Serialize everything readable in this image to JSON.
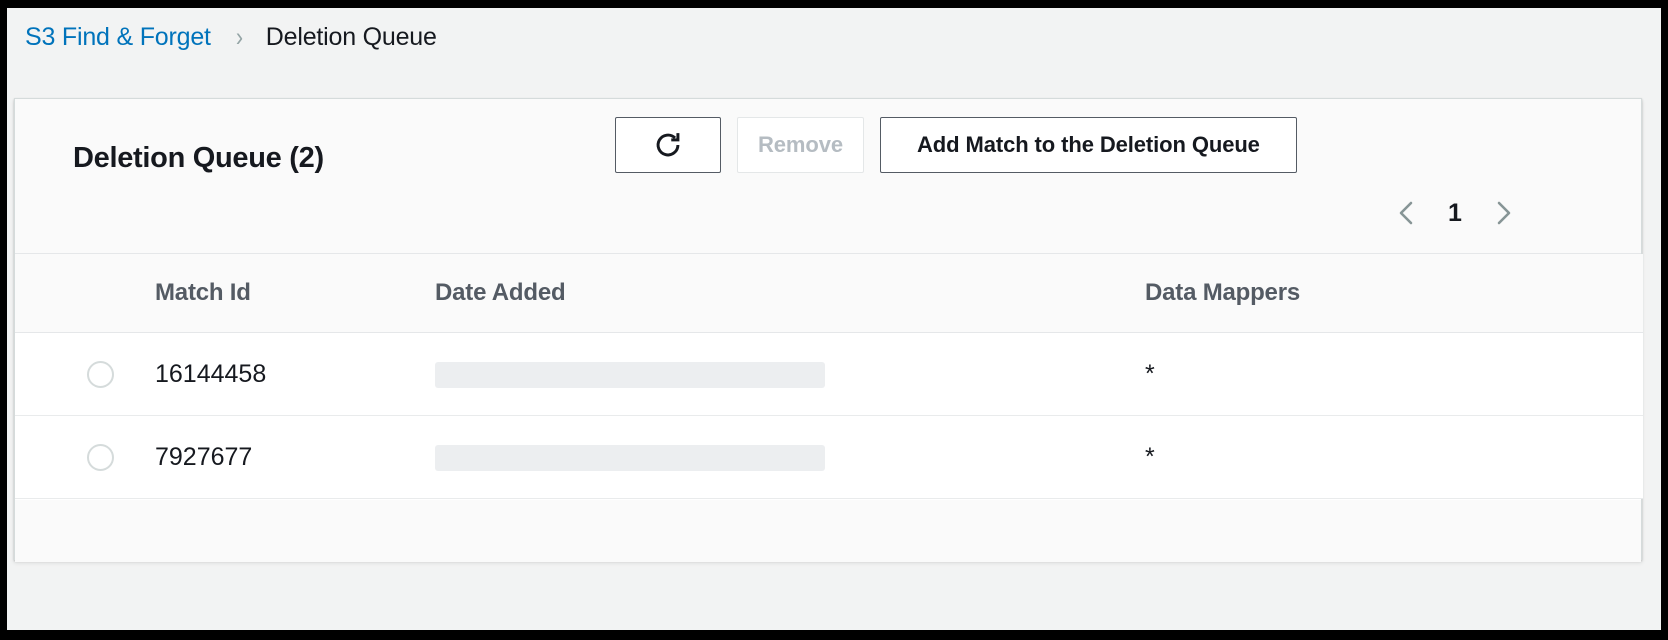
{
  "breadcrumb": {
    "root_label": "S3 Find & Forget",
    "separator": "›",
    "current_label": "Deletion Queue"
  },
  "card": {
    "title": "Deletion Queue (2)",
    "actions": {
      "refresh_icon": "refresh-icon",
      "remove_label": "Remove",
      "remove_disabled": true,
      "add_match_label": "Add Match to the Deletion Queue"
    },
    "pagination": {
      "previous_icon": "chevron-left-icon",
      "next_icon": "chevron-right-icon",
      "current_page": "1"
    },
    "table": {
      "columns": [
        "",
        "Match Id",
        "Date Added",
        "Data Mappers"
      ],
      "rows": [
        {
          "selected": false,
          "match_id": "16144458",
          "date_added": "",
          "date_added_redacted": true,
          "data_mappers": "*"
        },
        {
          "selected": false,
          "match_id": "7927677",
          "date_added": "",
          "date_added_redacted": true,
          "data_mappers": "*"
        }
      ]
    }
  },
  "colors": {
    "link": "#0073bb",
    "text": "#16191f",
    "muted": "#545b64",
    "disabled": "#b5bcc2",
    "border": "#d5dbdb",
    "panel_bg": "#f2f3f3",
    "header_bg": "#fafafa",
    "redacted": "#eceef0"
  }
}
